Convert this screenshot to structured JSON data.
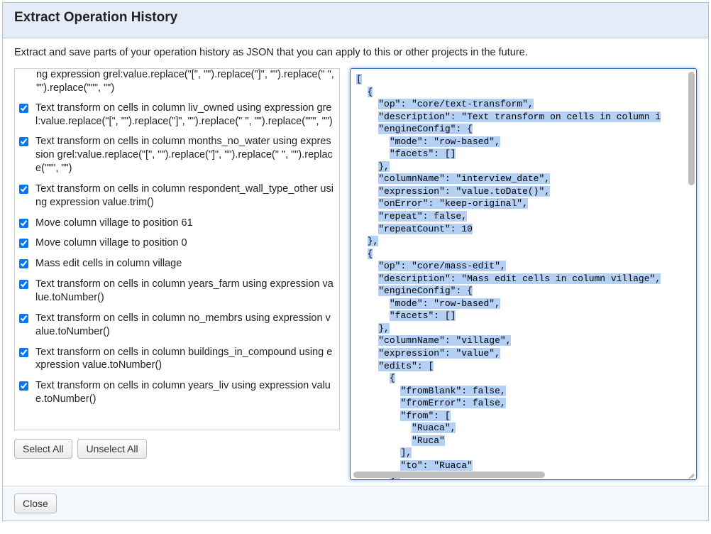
{
  "dialog": {
    "title": "Extract Operation History",
    "instructions": "Extract and save parts of your operation history as JSON that you can apply to this or other projects in the future."
  },
  "left": {
    "clipped_first_line": "ng expression grel:value.replace(\"[\", \"\").replace(\"]\", \"\").replace(\" \", \"\").replace(\"\"\", \"\")",
    "ops": [
      {
        "checked": true,
        "label": "Text transform on cells in column liv_owned using expression grel:value.replace(\"[\", \"\").replace(\"]\", \"\").replace(\" \", \"\").replace(\"\"\", \"\")"
      },
      {
        "checked": true,
        "label": "Text transform on cells in column months_no_water using expression grel:value.replace(\"[\", \"\").replace(\"]\", \"\").replace(\" \", \"\").replace(\"\"\", \"\")"
      },
      {
        "checked": true,
        "label": "Text transform on cells in column respondent_wall_type_other using expression value.trim()"
      },
      {
        "checked": true,
        "label": "Move column village to position 61"
      },
      {
        "checked": true,
        "label": "Move column village to position 0"
      },
      {
        "checked": true,
        "label": "Mass edit cells in column village"
      },
      {
        "checked": true,
        "label": "Text transform on cells in column years_farm using expression value.toNumber()"
      },
      {
        "checked": true,
        "label": "Text transform on cells in column no_membrs using expression value.toNumber()"
      },
      {
        "checked": true,
        "label": "Text transform on cells in column buildings_in_compound using expression value.toNumber()"
      },
      {
        "checked": true,
        "label": "Text transform on cells in column years_liv using expression value.toNumber()"
      }
    ],
    "select_all_label": "Select All",
    "unselect_all_label": "Unselect All"
  },
  "json_text": "[\n  {\n    \"op\": \"core/text-transform\",\n    \"description\": \"Text transform on cells in column i\n    \"engineConfig\": {\n      \"mode\": \"row-based\",\n      \"facets\": []\n    },\n    \"columnName\": \"interview_date\",\n    \"expression\": \"value.toDate()\",\n    \"onError\": \"keep-original\",\n    \"repeat\": false,\n    \"repeatCount\": 10\n  },\n  {\n    \"op\": \"core/mass-edit\",\n    \"description\": \"Mass edit cells in column village\",\n    \"engineConfig\": {\n      \"mode\": \"row-based\",\n      \"facets\": []\n    },\n    \"columnName\": \"village\",\n    \"expression\": \"value\",\n    \"edits\": [\n      {\n        \"fromBlank\": false,\n        \"fromError\": false,\n        \"from\": [\n          \"Ruaca\",\n          \"Ruca\"\n        ],\n        \"to\": \"Ruaca\"\n      },\n      {\n        \"fromBlank\": false,\n        \"fromError\": false,\n        \"from\": [",
  "footer": {
    "close_label": "Close"
  }
}
